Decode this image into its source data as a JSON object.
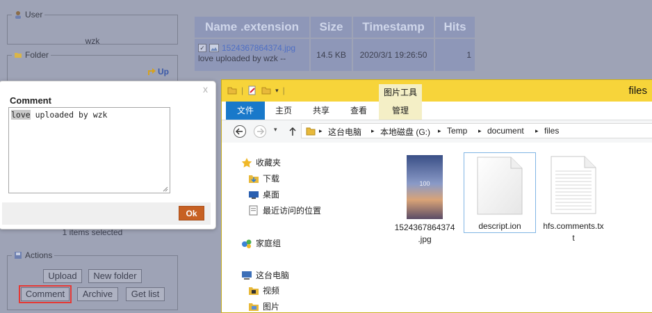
{
  "sidebar": {
    "user": {
      "legend": "User",
      "value": "wzk"
    },
    "folder": {
      "legend": "Folder",
      "up_label": "Up"
    },
    "selection_text": "1 items selected",
    "actions": {
      "legend": "Actions",
      "upload": "Upload",
      "new_folder": "New folder",
      "comment": "Comment",
      "archive": "Archive",
      "get_list": "Get list"
    }
  },
  "file_table": {
    "headers": [
      "Name .extension",
      "Size",
      "Timestamp",
      "Hits"
    ],
    "row": {
      "name": "1524367864374.jpg",
      "comment": "love uploaded by wzk --",
      "size": "14.5 KB",
      "timestamp": "2020/3/1 19:26:50",
      "hits": "1"
    }
  },
  "dialog": {
    "close": "x",
    "title": "Comment",
    "text_highlighted": "love",
    "text_rest": " uploaded by wzk",
    "ok": "Ok"
  },
  "explorer": {
    "title": "files",
    "context_tab": "图片工具",
    "ribbon_tabs": [
      "文件",
      "主页",
      "共享",
      "查看",
      "管理"
    ],
    "breadcrumb": [
      "这台电脑",
      "本地磁盘 (G:)",
      "Temp",
      "document",
      "files"
    ],
    "nav": {
      "favorites": "收藏夹",
      "downloads": "下载",
      "desktop": "桌面",
      "recent": "最近访问的位置",
      "homegroup": "家庭组",
      "this_pc": "这台电脑",
      "videos": "视频",
      "pictures": "图片"
    },
    "files": [
      {
        "line1": "1524367864374",
        "line2": ".jpg"
      },
      {
        "line1": "descript.ion",
        "line2": ""
      },
      {
        "line1": "hfs.comments.tx",
        "line2": "t"
      }
    ],
    "thumb_overlay": "100"
  }
}
